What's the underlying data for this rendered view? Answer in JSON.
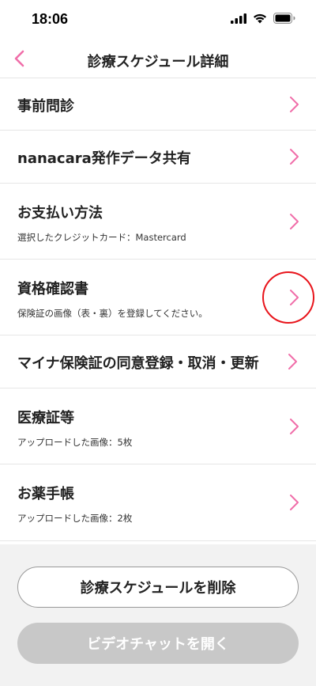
{
  "status_bar": {
    "time": "18:06",
    "icons": [
      "signal-icon",
      "wifi-icon",
      "battery-icon"
    ]
  },
  "nav": {
    "back_icon": "chevron-left-icon",
    "title": "診療スケジュール詳細"
  },
  "items": [
    {
      "title": "事前問診",
      "subtitle": ""
    },
    {
      "title": "nanacara発作データ共有",
      "subtitle": ""
    },
    {
      "title": "お支払い方法",
      "subtitle": "選択したクレジットカード：Mastercard"
    },
    {
      "title": "資格確認書",
      "subtitle": "保険証の画像（表・裏）を登録してください。",
      "highlighted": true
    },
    {
      "title": "マイナ保険証の同意登録・取消・更新",
      "subtitle": ""
    },
    {
      "title": "医療証等",
      "subtitle": "アップロードした画像：5枚"
    },
    {
      "title": "お薬手帳",
      "subtitle": "アップロードした画像：2枚"
    }
  ],
  "footer": {
    "delete_label": "診療スケジュールを削除",
    "video_label": "ビデオチャットを開く",
    "video_enabled": false
  },
  "colors": {
    "accent_pink": "#f06ea9",
    "highlight_red": "#e8141b",
    "disabled_button": "#c8c8c8",
    "footer_bg": "#f2f2f2"
  }
}
